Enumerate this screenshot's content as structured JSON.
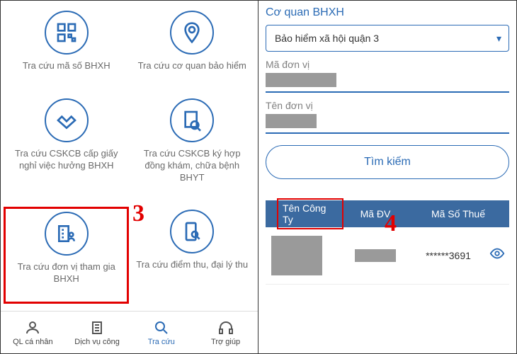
{
  "left": {
    "items": [
      {
        "label": "Tra cứu mã số BHXH"
      },
      {
        "label": "Tra cứu cơ quan bảo hiểm"
      },
      {
        "label": "Tra cứu CSKCB cấp giấy nghỉ việc hưởng BHXH"
      },
      {
        "label": "Tra cứu CSKCB ký hợp đồng khám, chữa bệnh BHYT"
      },
      {
        "label": "Tra cứu đơn vị tham gia BHXH"
      },
      {
        "label": "Tra cứu điểm thu, đại lý thu"
      }
    ],
    "annotation": "3",
    "nav": {
      "personal": "QL cá nhân",
      "public": "Dịch vụ công",
      "lookup": "Tra cứu",
      "help": "Trợ giúp"
    }
  },
  "right": {
    "agency_label": "Cơ quan BHXH",
    "agency_value": "Bảo hiểm xã hội quận 3",
    "unit_code_label": "Mã đơn vị",
    "unit_name_label": "Tên đơn vị",
    "search_label": "Tìm kiếm",
    "annotation": "4",
    "headers": {
      "company": "Tên Công Ty",
      "unitcode": "Mã ĐV",
      "taxcode": "Mã Số Thuế"
    },
    "row": {
      "tax_masked": "******3691"
    }
  }
}
